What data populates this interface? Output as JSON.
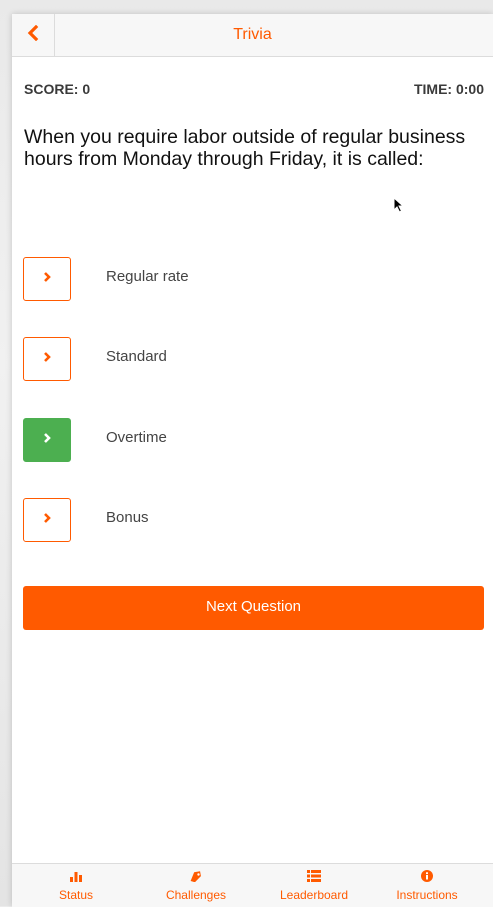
{
  "colors": {
    "accent": "#ff5a00",
    "correct": "#4caf50"
  },
  "header": {
    "back_icon": "chevron-left-icon",
    "title": "Trivia"
  },
  "stats": {
    "score": "SCORE: 0",
    "time": "TIME: 0:00"
  },
  "question": {
    "text": "When you require labor outside of regular business hours from Monday through Friday, it is called:"
  },
  "options": [
    {
      "label": "Regular rate",
      "state": "default",
      "icon": "chevron-right-icon"
    },
    {
      "label": "Standard",
      "state": "default",
      "icon": "chevron-right-icon"
    },
    {
      "label": "Overtime",
      "state": "correct",
      "icon": "chevron-right-icon"
    },
    {
      "label": "Bonus",
      "state": "default",
      "icon": "chevron-right-icon"
    }
  ],
  "next_button": {
    "label": "Next Question"
  },
  "tabs": [
    {
      "label": "Status",
      "icon": "bar-chart-icon"
    },
    {
      "label": "Challenges",
      "icon": "tag-icon"
    },
    {
      "label": "Leaderboard",
      "icon": "list-icon"
    },
    {
      "label": "Instructions",
      "icon": "info-icon"
    }
  ]
}
